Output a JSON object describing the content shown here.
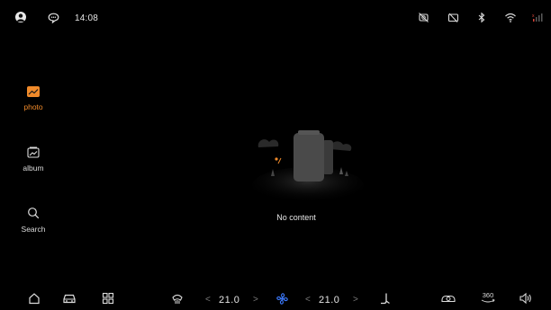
{
  "status_bar": {
    "time": "14:08",
    "icons": [
      "user-avatar-icon",
      "message-icon",
      "no-camera-icon",
      "screen-off-icon",
      "bluetooth-icon",
      "wifi-icon",
      "signal-icon"
    ]
  },
  "sidebar": {
    "items": [
      {
        "label": "photo",
        "icon": "photo-icon",
        "active": true
      },
      {
        "label": "album",
        "icon": "album-icon",
        "active": false
      },
      {
        "label": "Search",
        "icon": "search-icon",
        "active": false
      }
    ]
  },
  "main": {
    "empty_text": "No content"
  },
  "dock": {
    "left_temp": "21.0",
    "right_temp": "21.0",
    "left_temp_prev": "<",
    "left_temp_next": ">",
    "right_temp_prev": "<",
    "right_temp_next": ">",
    "view_360_label": "360",
    "icons": [
      "home-icon",
      "car-icon",
      "apps-grid-icon",
      "defrost-icon",
      "fan-icon",
      "seat-heat-icon",
      "car-mode-icon",
      "view-360-icon",
      "volume-icon"
    ]
  },
  "colors": {
    "accent": "#f08a2a",
    "fan_blue": "#3d7bff",
    "background": "#000000",
    "text": "#e6e6e6"
  }
}
